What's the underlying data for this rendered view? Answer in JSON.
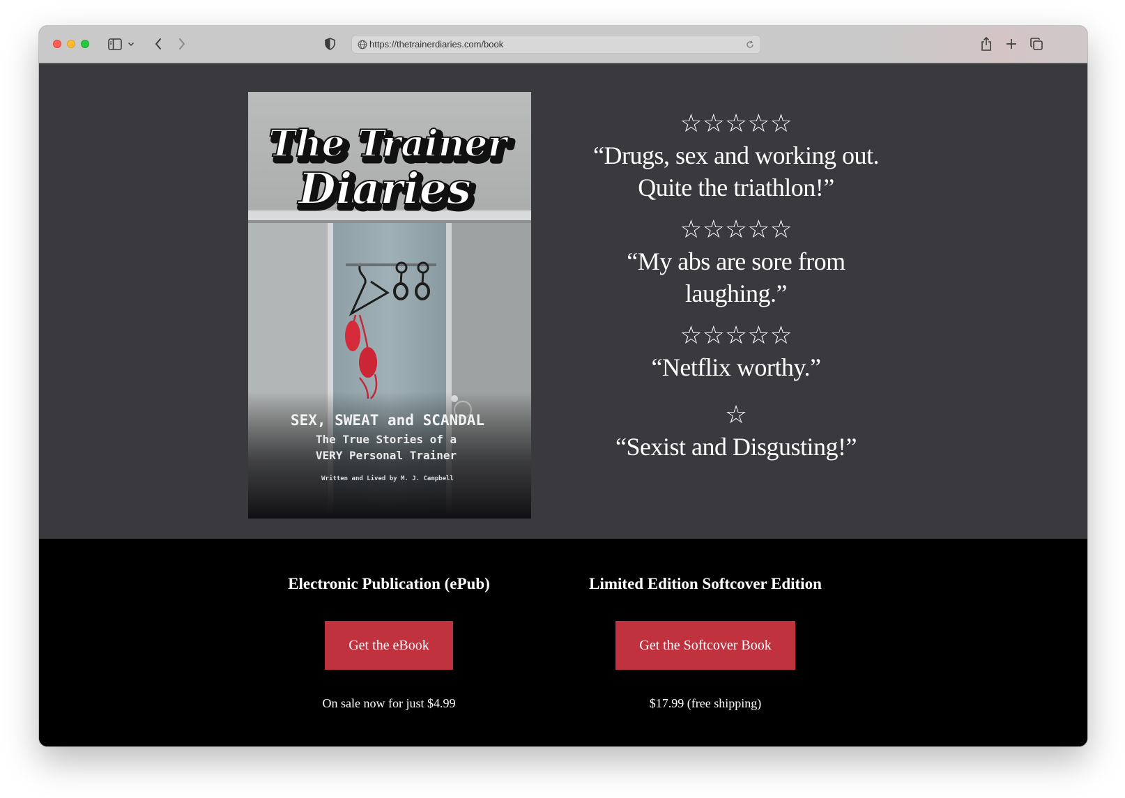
{
  "browser": {
    "url": "https://thetrainerdiaries.com/book",
    "icons": [
      "sidebar-icon",
      "chevron-down-icon",
      "back-icon",
      "forward-icon",
      "shield-icon",
      "globe-icon",
      "reload-icon",
      "share-icon",
      "plus-icon",
      "tabs-icon"
    ]
  },
  "cover": {
    "title_line1": "The Trainer",
    "title_line2": "Diaries",
    "tagline": "SEX, SWEAT and SCANDAL",
    "subtitle_line1": "The True Stories of a",
    "subtitle_line2": "VERY Personal Trainer",
    "byline": "Written and Lived by M. J. Campbell"
  },
  "reviews": [
    {
      "stars": "☆☆☆☆☆",
      "rating": 5,
      "quote_line1": "“Drugs, sex and working out.",
      "quote_line2": "Quite the triathlon!”"
    },
    {
      "stars": "☆☆☆☆☆",
      "rating": 5,
      "quote_line1": "“My abs are sore from",
      "quote_line2": "laughing.”"
    },
    {
      "stars": "☆☆☆☆☆",
      "rating": 5,
      "quote_line1": "“Netflix worthy.”",
      "quote_line2": ""
    },
    {
      "stars": "☆",
      "rating": 1,
      "quote_line1": "“Sexist and Disgusting!”",
      "quote_line2": ""
    }
  ],
  "offers": {
    "epub": {
      "title": "Electronic Publication (ePub)",
      "button": "Get the eBook",
      "price": "On sale now for just $4.99"
    },
    "softcover": {
      "title": "Limited Edition Softcover Edition",
      "button": "Get the Softcover Book",
      "price": "$17.99 (free shipping)"
    }
  },
  "colors": {
    "page_bg": "#39393e",
    "footer_bg": "#000000",
    "button": "#c1323f",
    "bra": "#d42a3a"
  }
}
